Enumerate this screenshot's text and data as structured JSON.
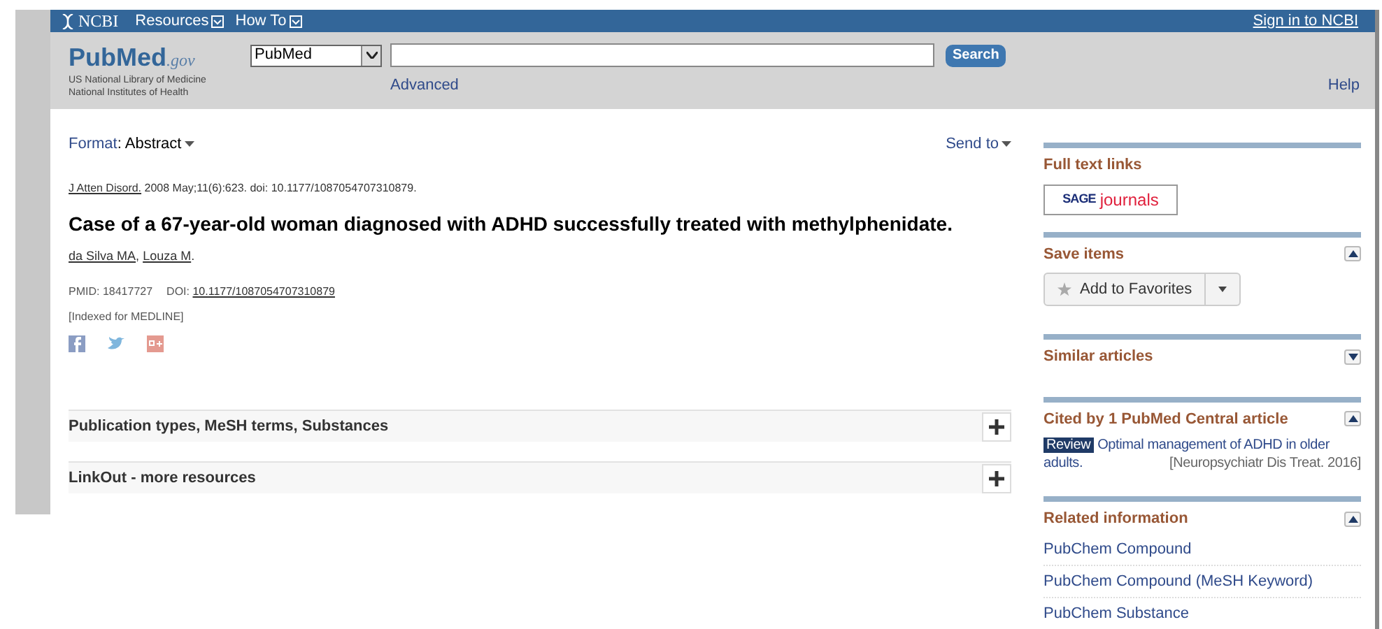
{
  "topbar": {
    "brand": "NCBI",
    "menus": [
      "Resources",
      "How To"
    ],
    "sign_in": "Sign in to NCBI"
  },
  "header": {
    "logo": "PubMed",
    "logo_suffix": ".gov",
    "org_lines": [
      "US National Library of Medicine",
      "National Institutes of Health"
    ],
    "database": "PubMed",
    "search_button": "Search",
    "advanced": "Advanced",
    "help": "Help"
  },
  "toolbar": {
    "format_label": "Format",
    "format_separator": ":",
    "format_value": "Abstract",
    "send_to": "Send to"
  },
  "article": {
    "journal": "J Atten Disord.",
    "citation": "2008 May;11(6):623. doi: 10.1177/1087054707310879.",
    "title": "Case of a 67-year-old woman diagnosed with ADHD successfully treated with methylphenidate.",
    "authors": [
      "da Silva MA",
      "Louza M"
    ],
    "author_separator": ",",
    "authors_end": ".",
    "pmid": "PMID: 18417727",
    "doi_label": "DOI:",
    "doi": "10.1177/1087054707310879",
    "indexed": "[Indexed for MEDLINE]"
  },
  "accordions": [
    {
      "title": "Publication types, MeSH terms, Substances",
      "expanded": false
    },
    {
      "title": "LinkOut - more resources",
      "expanded": false
    }
  ],
  "sidebar": [
    {
      "kind": "fulltext",
      "title": "Full text links",
      "logo_a": "SAGE",
      "logo_b": "journals"
    },
    {
      "kind": "save",
      "title": "Save items",
      "expanded": true,
      "button": "Add to Favorites"
    },
    {
      "kind": "plain",
      "title": "Similar articles",
      "expanded": false
    },
    {
      "kind": "cited",
      "title": "Cited by 1 PubMed Central article",
      "expanded": true,
      "tag": "Review",
      "article": "Optimal management of ADHD in older adults.",
      "source": "[Neuropsychiatr Dis Treat. 2016]"
    },
    {
      "kind": "links",
      "title": "Related information",
      "expanded": true,
      "links": [
        "PubChem Compound",
        "PubChem Compound (MeSH Keyword)",
        "PubChem Substance"
      ]
    }
  ]
}
